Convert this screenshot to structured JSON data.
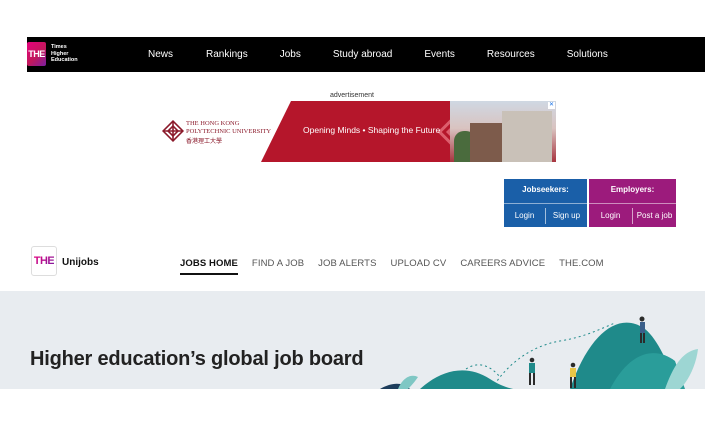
{
  "topnav": {
    "logo_text": "THE",
    "brand_lines": [
      "Times",
      "Higher",
      "Education"
    ],
    "links": [
      "News",
      "Rankings",
      "Jobs",
      "Study abroad",
      "Events",
      "Resources",
      "Solutions"
    ]
  },
  "ad": {
    "label": "advertisement",
    "university_en_1": "The Hong Kong",
    "university_en_2": "Polytechnic University",
    "university_cn": "香港理工大學",
    "slogan": "Opening Minds • Shaping the Future",
    "close": "✕"
  },
  "cta": {
    "jobseekers": {
      "title": "Jobseekers:",
      "login": "Login",
      "signup": "Sign up",
      "color": "#1a5fa8"
    },
    "employers": {
      "title": "Employers:",
      "login": "Login",
      "post": "Post a job",
      "color": "#9c1b7c"
    }
  },
  "unijobs": {
    "logo_text": "THE",
    "name": "Unijobs",
    "nav": [
      {
        "label": "JOBS HOME",
        "active": true
      },
      {
        "label": "FIND A JOB",
        "active": false
      },
      {
        "label": "JOB ALERTS",
        "active": false
      },
      {
        "label": "UPLOAD CV",
        "active": false
      },
      {
        "label": "CAREERS ADVICE",
        "active": false
      },
      {
        "label": "THE.COM",
        "active": false
      }
    ]
  },
  "hero": {
    "title": "Higher education’s global job board",
    "accent": "#1f8a8a"
  }
}
